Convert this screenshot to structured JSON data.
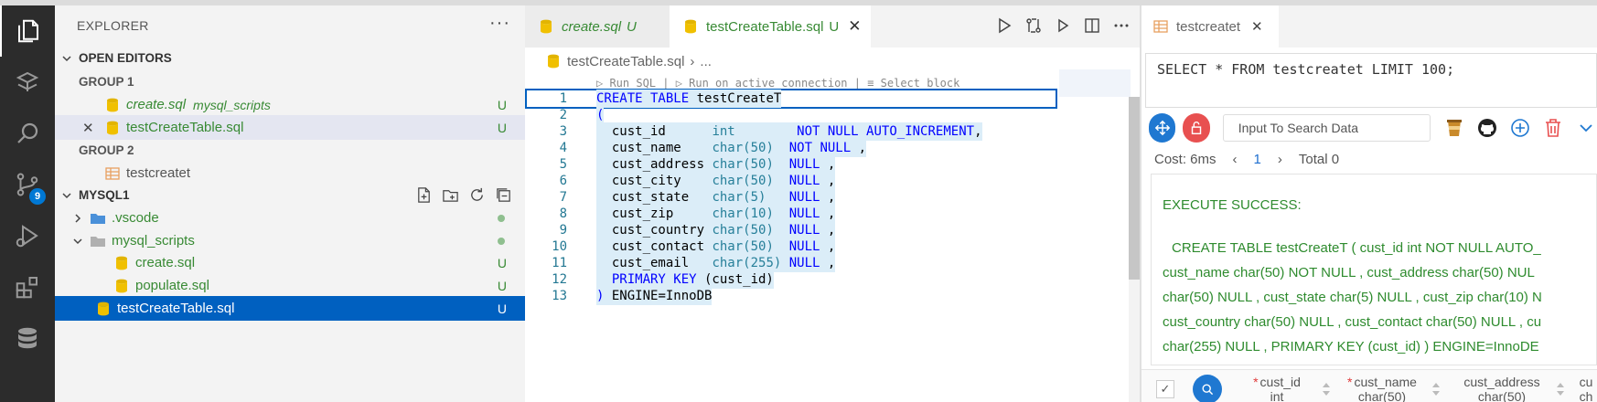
{
  "sidebar": {
    "title": "EXPLORER",
    "more": "···",
    "open_editors": {
      "header": "OPEN EDITORS",
      "group1": "GROUP 1",
      "group1_items": [
        {
          "name": "create.sql",
          "desc": "mysql_scripts",
          "status": "U"
        },
        {
          "name": "testCreateTable.sql",
          "status": "U"
        }
      ],
      "group2": "GROUP 2",
      "group2_items": [
        {
          "name": "testcreatet"
        }
      ]
    },
    "folder": {
      "header": "MYSQL1",
      "items": [
        {
          "name": ".vscode"
        },
        {
          "name": "mysql_scripts"
        },
        {
          "name": "create.sql",
          "status": "U"
        },
        {
          "name": "populate.sql",
          "status": "U"
        },
        {
          "name": "testCreateTable.sql",
          "status": "U"
        }
      ]
    },
    "scm_badge": "9"
  },
  "editor": {
    "tabs": [
      {
        "name": "create.sql",
        "status": "U"
      },
      {
        "name": "testCreateTable.sql",
        "status": "U",
        "close": "✕"
      }
    ],
    "breadcrumb": {
      "file": "testCreateTable.sql",
      "rest": "..."
    },
    "codelens": "▷ Run SQL | ▷ Run on active connection | ≡ Select block",
    "line_numbers": [
      "1",
      "2",
      "3",
      "4",
      "5",
      "6",
      "7",
      "8",
      "9",
      "10",
      "11",
      "12",
      "13"
    ]
  },
  "panel": {
    "tab": "testcreatet",
    "tab_close": "✕",
    "query": "SELECT * FROM testcreatet LIMIT 100;",
    "search_placeholder": "Input To Search Data",
    "cost": "Cost: 6ms",
    "page": "1",
    "total": "Total 0",
    "result_title": "EXECUTE SUCCESS:",
    "result_lines": [
      "CREATE TABLE testCreateT ( cust_id int NOT NULL AUTO_",
      "cust_name char(50) NOT NULL , cust_address char(50) NUL",
      "char(50) NULL , cust_state char(5) NULL , cust_zip char(10) N",
      "cust_country char(50) NULL , cust_contact char(50) NULL , cu",
      "char(255) NULL , PRIMARY KEY (cust_id) ) ENGINE=InnoDE"
    ],
    "columns": [
      {
        "name": "cust_id",
        "type": "int",
        "required": "*"
      },
      {
        "name": "cust_name",
        "type": "char(50)",
        "required": "*"
      },
      {
        "name": "cust_address",
        "type": "char(50)",
        "required": ""
      },
      {
        "name": "cu",
        "type": "ch",
        "required": ""
      }
    ]
  },
  "colors": {
    "accent": "#0060c0",
    "untracked": "#388a34",
    "success": "#2e8b2e",
    "activity_bg": "#2c2c2c"
  }
}
